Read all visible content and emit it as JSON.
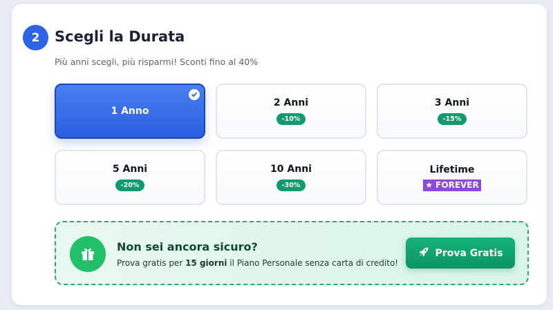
{
  "step": {
    "number": "2",
    "title": "Scegli la Durata",
    "subtitle": "Più anni scegli, più risparmi! Sconti fino al 40%"
  },
  "options": [
    {
      "label": "1 Anno",
      "discount": "",
      "selected": true
    },
    {
      "label": "2 Anni",
      "discount": "-10%",
      "selected": false
    },
    {
      "label": "3 Anni",
      "discount": "-15%",
      "selected": false
    },
    {
      "label": "5 Anni",
      "discount": "-20%",
      "selected": false
    },
    {
      "label": "10 Anni",
      "discount": "-30%",
      "selected": false
    },
    {
      "label": "Lifetime",
      "badge": "★ FOREVER",
      "selected": false
    }
  ],
  "trial": {
    "title": "Non sei ancora sicuro?",
    "text_before": "Prova gratis per ",
    "text_bold": "15 giorni",
    "text_after": " il Piano Personale senza carta di credito!",
    "button_label": "Prova Gratis",
    "icons": {
      "gift": "gift-icon",
      "button": "rocket-icon"
    }
  },
  "colors": {
    "accent": "#2f63e6",
    "selected_bg": "#3a6fea",
    "discount_badge": "#129a6a",
    "forever_badge": "#8d48e0",
    "trial_green": "#22c06a"
  }
}
